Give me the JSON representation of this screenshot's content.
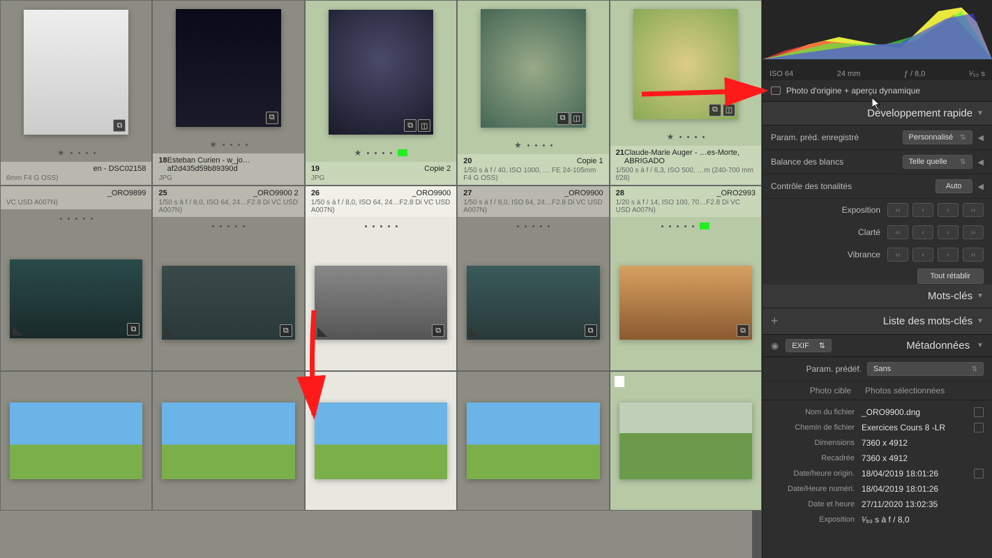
{
  "histo": {
    "iso": "ISO 64",
    "focal": "24 mm",
    "fstop": "ƒ / 8,0",
    "shutter": "¹⁄₅₀ s"
  },
  "origin": "Photo d'origine + aperçu dynamique",
  "panels": {
    "dev": "Développement rapide",
    "keys": "Mots-clés",
    "keylist": "Liste des mots-clés",
    "meta": "Métadonnées"
  },
  "dev": {
    "preset_l": "Param. préd. enregistré",
    "preset_v": "Personnalisé",
    "wb_l": "Balance des blancs",
    "wb_v": "Telle quelle",
    "tone_l": "Contrôle des tonalités",
    "tone_v": "Auto",
    "expo": "Exposition",
    "clarity": "Clarté",
    "vibrance": "Vibrance",
    "reset": "Tout rétablir",
    "b1": "‹‹",
    "b2": "‹",
    "b3": "›",
    "b4": "››"
  },
  "exif": {
    "label": "EXIF",
    "preset_l": "Param. prédéf.",
    "preset_v": "Sans",
    "tab1": "Photo cible",
    "tab2": "Photos sélectionnées"
  },
  "meta": {
    "f1_l": "Nom du fichier",
    "f1_v": "_ORO9900.dng",
    "f2_l": "Chemin de fichier",
    "f2_v": "Exercices Cours 8 -LR",
    "f3_l": "Dimensions",
    "f3_v": "7360 x 4912",
    "f4_l": "Recadrée",
    "f4_v": "7360 x 4912",
    "f5_l": "Date/heure origin.",
    "f5_v": "18/04/2019 18:01:26",
    "f6_l": "Date/Heure numéri.",
    "f6_v": "18/04/2019 18:01:26",
    "f7_l": "Date et heure",
    "f7_v": "27/11/2020 13:02:35",
    "f8_l": "Exposition",
    "f8_v": "¹⁄₅₀ s à f / 8,0"
  },
  "cells": [
    [
      {
        "num": "",
        "title": "en - DSC02158",
        "meta": "6mm F4 G OSS)",
        "sel": false,
        "orient": "p",
        "thumb": "bw"
      },
      {
        "num": "18",
        "title": "Esteban Curien - w_jo…af2d435d59b89390d",
        "meta": "JPG",
        "sel": false,
        "orient": "p",
        "thumb": "night1"
      },
      {
        "num": "19",
        "title": "Copie 2",
        "meta": "JPG",
        "sel": true,
        "orient": "p",
        "thumb": "night2",
        "flag": true
      },
      {
        "num": "20",
        "title": "Copie 1",
        "meta": "1/50 s à f / 40, ISO 1000, … FE 24-105mm F4 G OSS)",
        "sel": true,
        "orient": "p",
        "thumb": "fly1"
      },
      {
        "num": "21",
        "title": "Claude-Marie Auger - …es-Morte, ABRIGADO",
        "meta": "1/500 s à f / 6,3, ISO 500, …m (240-700 mm f/28)",
        "sel": true,
        "orient": "p",
        "thumb": "fly2"
      }
    ],
    [
      {
        "num": "",
        "title": "_ORO9899",
        "meta": "VC USD A007N)",
        "sel": false,
        "orient": "l",
        "thumb": "joker1"
      },
      {
        "num": "25",
        "title": "_ORO9900 2",
        "meta": "1/50 s à f / 8,0, ISO 64, 24…F2.8 Di VC USD A007N)",
        "sel": false,
        "orient": "l",
        "thumb": "joker2"
      },
      {
        "num": "26",
        "title": "_ORO9900",
        "meta": "1/50 s à f / 8,0, ISO 64, 24…F2.8 Di VC USD A007N)",
        "sel": false,
        "orient": "l",
        "thumb": "joker3",
        "active": true
      },
      {
        "num": "27",
        "title": "_ORO9900",
        "meta": "1/50 s à f / 8,0, ISO 64, 24…F2.8 Di VC USD A007N)",
        "sel": false,
        "orient": "l",
        "thumb": "joker4"
      },
      {
        "num": "28",
        "title": "_ORO2993",
        "meta": "1/20 s à f / 14, ISO 100, 70…F2.8 Di VC USD A007N)",
        "sel": true,
        "orient": "l",
        "thumb": "horse",
        "flag": true
      }
    ],
    [
      {
        "num": "",
        "title": "",
        "meta": "",
        "sel": false,
        "orient": "l",
        "thumb": "field"
      },
      {
        "num": "",
        "title": "",
        "meta": "",
        "sel": false,
        "orient": "l",
        "thumb": "field"
      },
      {
        "num": "",
        "title": "",
        "meta": "",
        "sel": false,
        "orient": "l",
        "thumb": "field",
        "active": true
      },
      {
        "num": "",
        "title": "",
        "meta": "",
        "sel": false,
        "orient": "l",
        "thumb": "field"
      },
      {
        "num": "",
        "title": "",
        "meta": "",
        "sel": true,
        "orient": "l",
        "thumb": "green",
        "whiteflag": true
      }
    ]
  ]
}
